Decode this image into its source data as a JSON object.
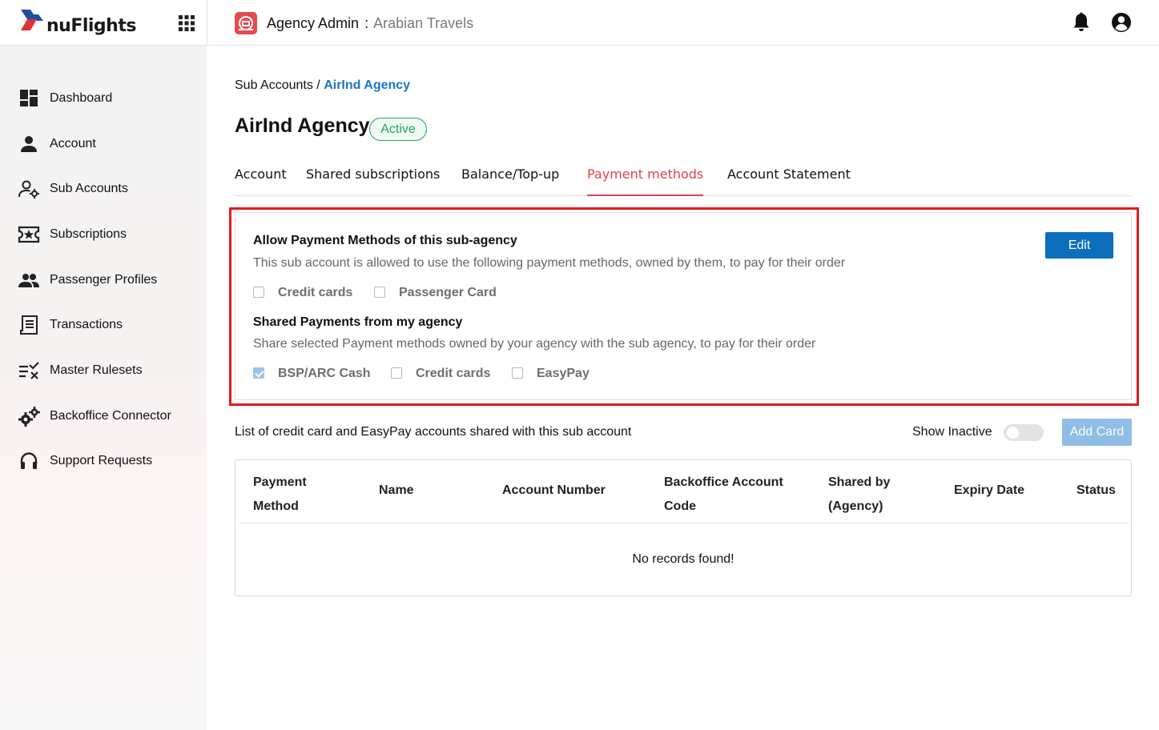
{
  "header": {
    "logo_text": "nuFlights",
    "admin_label": "Agency Admin",
    "separator": ":",
    "org_name": "Arabian Travels"
  },
  "sidebar": {
    "items": [
      {
        "label": "Dashboard",
        "icon": "dashboard-icon"
      },
      {
        "label": "Account",
        "icon": "person-icon"
      },
      {
        "label": "Sub Accounts",
        "icon": "sub-accounts-icon"
      },
      {
        "label": "Subscriptions",
        "icon": "ticket-star-icon"
      },
      {
        "label": "Passenger Profiles",
        "icon": "people-icon"
      },
      {
        "label": "Transactions",
        "icon": "receipt-icon"
      },
      {
        "label": "Master Rulesets",
        "icon": "rules-icon"
      },
      {
        "label": "Backoffice Connector",
        "icon": "gears-icon"
      },
      {
        "label": "Support Requests",
        "icon": "headset-icon"
      }
    ]
  },
  "breadcrumb": {
    "parent": "Sub Accounts",
    "separator": "/",
    "current": "AirInd Agency"
  },
  "page": {
    "title": "AirInd Agency",
    "status": "Active"
  },
  "tabs": [
    {
      "label": "Account",
      "active": false
    },
    {
      "label": "Shared subscriptions",
      "active": false
    },
    {
      "label": "Balance/Top-up",
      "active": false
    },
    {
      "label": "Payment methods",
      "active": true
    },
    {
      "label": "Account Statement",
      "active": false
    }
  ],
  "allow_section": {
    "title": "Allow Payment Methods of this sub-agency",
    "description": "This sub account is allowed to use the following payment methods, owned by them, to pay for their order",
    "options": [
      {
        "label": "Credit cards",
        "checked": false
      },
      {
        "label": "Passenger Card",
        "checked": false
      }
    ],
    "edit_label": "Edit"
  },
  "shared_section": {
    "title": "Shared Payments from my agency",
    "description": "Share selected Payment methods owned by your agency with the sub agency, to pay for their order",
    "options": [
      {
        "label": "BSP/ARC Cash",
        "checked": true
      },
      {
        "label": "Credit cards",
        "checked": false
      },
      {
        "label": "EasyPay",
        "checked": false
      }
    ]
  },
  "list": {
    "caption": "List of credit card and EasyPay accounts shared with this sub account",
    "show_inactive_label": "Show Inactive",
    "show_inactive_on": false,
    "add_card_label": "Add Card",
    "columns": [
      [
        "Payment",
        "Method"
      ],
      [
        "Name"
      ],
      [
        "Account Number"
      ],
      [
        "Backoffice Account",
        "Code"
      ],
      [
        "Shared by",
        "(Agency)"
      ],
      [
        "Expiry Date"
      ],
      [
        "Status"
      ]
    ],
    "empty_message": "No records found!"
  },
  "colors": {
    "accent": "#e0424b",
    "link": "#1677c9",
    "primary_button": "#0d6ebd",
    "status_active": "#25a55a",
    "highlight_frame": "#e01b22"
  }
}
